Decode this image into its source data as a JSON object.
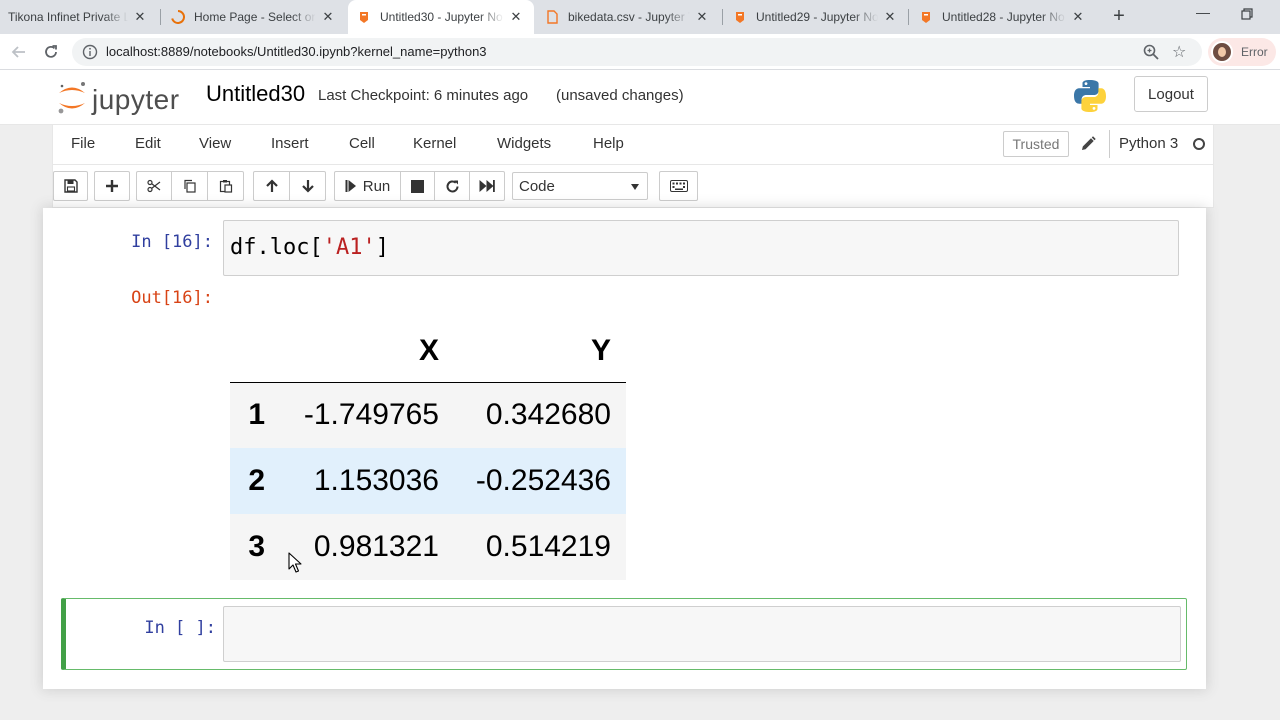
{
  "browser": {
    "tabs": [
      {
        "title": "Tikona Infinet Private Li"
      },
      {
        "title": "Home Page - Select or c"
      },
      {
        "title": "Untitled30 - Jupyter No"
      },
      {
        "title": "bikedata.csv - Jupyter T"
      },
      {
        "title": "Untitled29 - Jupyter No"
      },
      {
        "title": "Untitled28 - Jupyter No"
      }
    ],
    "url": "localhost:8889/notebooks/Untitled30.ipynb?kernel_name=python3",
    "profile_status": "Error"
  },
  "header": {
    "logo_text": "jupyter",
    "notebook_title": "Untitled30",
    "checkpoint": "Last Checkpoint: 6 minutes ago",
    "save_status": "(unsaved changes)",
    "logout_label": "Logout"
  },
  "menubar": {
    "items": [
      "File",
      "Edit",
      "View",
      "Insert",
      "Cell",
      "Kernel",
      "Widgets",
      "Help"
    ],
    "trusted_label": "Trusted",
    "kernel_name": "Python 3"
  },
  "toolbar": {
    "run_label": "Run",
    "cell_type": "Code"
  },
  "cells": {
    "cell1": {
      "in_prompt": "In [16]:",
      "code_prefix": "df.loc[",
      "code_string": "'A1'",
      "code_suffix": "]",
      "out_prompt": "Out[16]:"
    },
    "output_table": {
      "columns": [
        "X",
        "Y"
      ],
      "rows": [
        {
          "index": "1",
          "x": "-1.749765",
          "y": "0.342680"
        },
        {
          "index": "2",
          "x": "1.153036",
          "y": "-0.252436"
        },
        {
          "index": "3",
          "x": "0.981321",
          "y": "0.514219"
        }
      ]
    },
    "cell2": {
      "in_prompt": "In [ ]:"
    }
  }
}
